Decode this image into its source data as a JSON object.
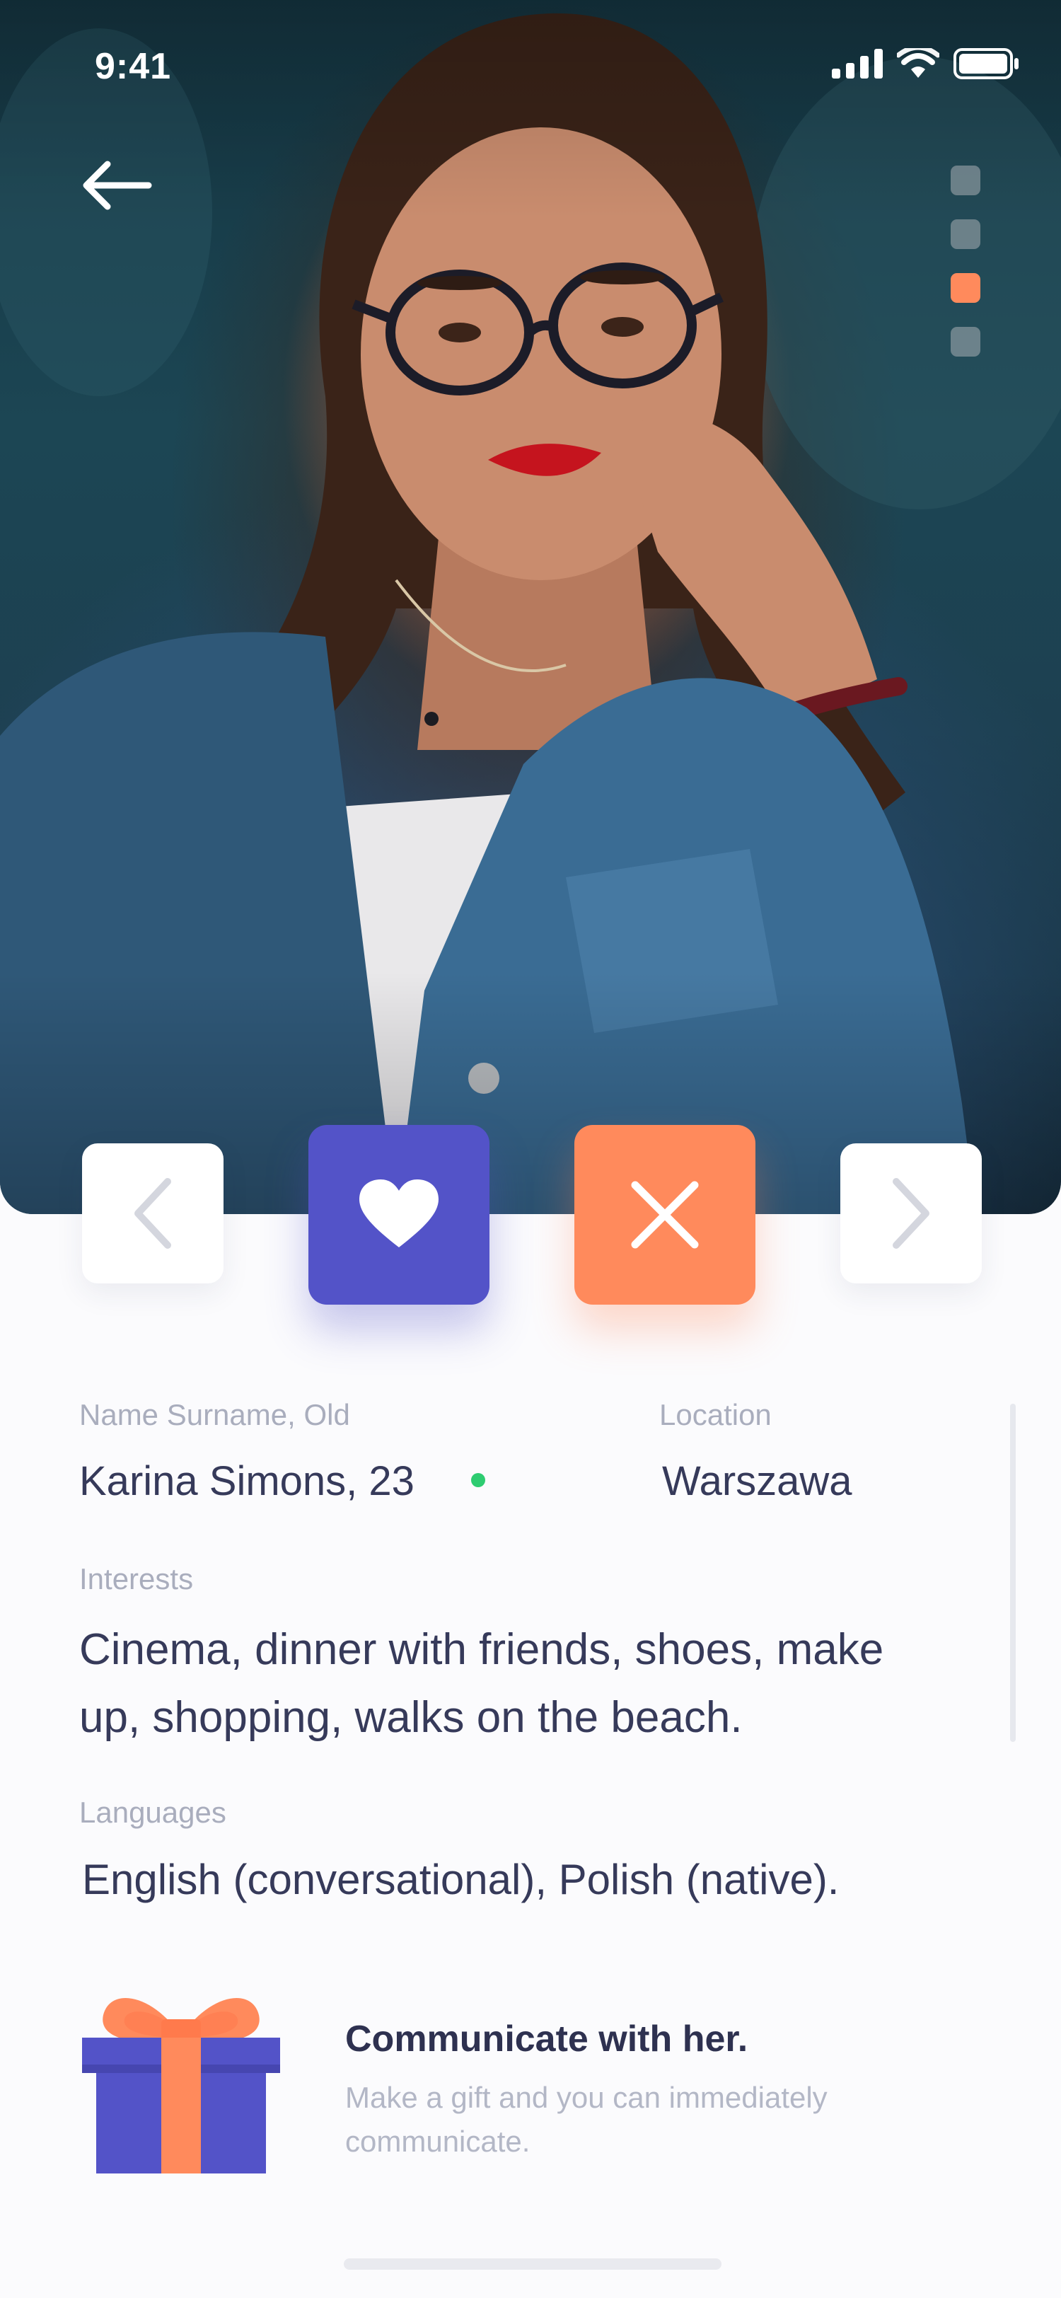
{
  "status_bar": {
    "time": "9:41"
  },
  "photo": {
    "pager_count": 4,
    "active_index": 2
  },
  "actions": {
    "prev_icon": "chevron-left-icon",
    "like_icon": "heart-icon",
    "dismiss_icon": "close-icon",
    "next_icon": "chevron-right-icon"
  },
  "profile": {
    "name_label": "Name Surname, Old",
    "name_value": "Karina Simons, 23",
    "location_label": "Location",
    "location_value": "Warszawa",
    "interests_label": "Interests",
    "interests_value": "Cinema, dinner with friends, shoes, make up, shopping, walks on the beach.",
    "languages_label": "Languages",
    "languages_value": "English (conversational), Polish (native)."
  },
  "gift": {
    "title": "Communicate with her.",
    "subtitle": "Make a gift and you can immediately communicate."
  },
  "colors": {
    "primary": "#5353c8",
    "accent": "#ff8a5c",
    "online": "#2ecc71"
  }
}
